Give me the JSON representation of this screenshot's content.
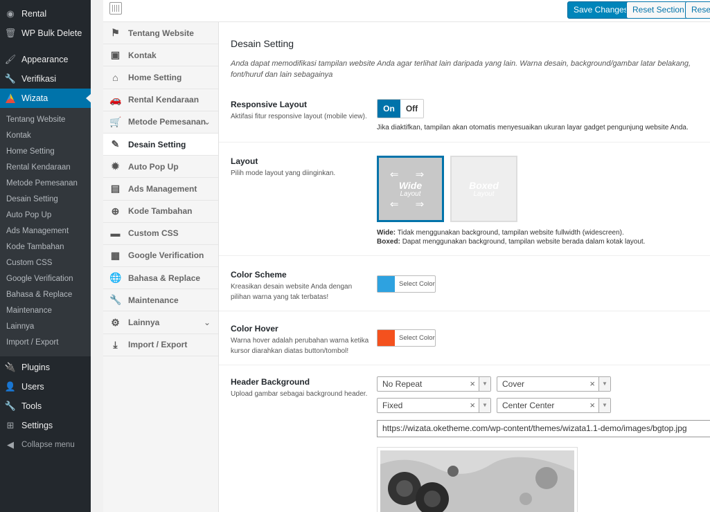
{
  "sidebar": {
    "top_items": [
      {
        "label": "Rental",
        "icon": "circle-icon"
      },
      {
        "label": "WP Bulk Delete",
        "icon": "trash-icon"
      },
      {
        "label": "Appearance",
        "icon": "brush-icon"
      },
      {
        "label": "Verifikasi",
        "icon": "wrench-icon"
      },
      {
        "label": "Wizata",
        "icon": "wizata-logo-icon"
      }
    ],
    "submenu": [
      "Tentang Website",
      "Kontak",
      "Home Setting",
      "Rental Kendaraan",
      "Metode Pemesanan",
      "Desain Setting",
      "Auto Pop Up",
      "Ads Management",
      "Kode Tambahan",
      "Custom CSS",
      "Google Verification",
      "Bahasa & Replace",
      "Maintenance",
      "Lainnya",
      "Import / Export"
    ],
    "bottom_items": [
      {
        "label": "Plugins",
        "icon": "plug-icon"
      },
      {
        "label": "Users",
        "icon": "user-icon"
      },
      {
        "label": "Tools",
        "icon": "wrench-icon"
      },
      {
        "label": "Settings",
        "icon": "settings-icon"
      }
    ],
    "collapse_label": "Collapse menu"
  },
  "toolbar": {
    "save_label": "Save Changes",
    "reset_section_label": "Reset Section",
    "reset_label": "Reset"
  },
  "nav": [
    {
      "label": "Tentang Website",
      "icon": "flag-icon"
    },
    {
      "label": "Kontak",
      "icon": "contact-card-icon"
    },
    {
      "label": "Home Setting",
      "icon": "home-icon"
    },
    {
      "label": "Rental Kendaraan",
      "icon": "car-icon"
    },
    {
      "label": "Metode Pemesanan",
      "icon": "cart-icon"
    },
    {
      "label": "Desain Setting",
      "icon": "magic-wand-icon"
    },
    {
      "label": "Auto Pop Up",
      "icon": "burst-icon"
    },
    {
      "label": "Ads Management",
      "icon": "chart-icon"
    },
    {
      "label": "Kode Tambahan",
      "icon": "plus-circle-icon"
    },
    {
      "label": "Custom CSS",
      "icon": "css-icon"
    },
    {
      "label": "Google Verification",
      "icon": "qrcode-icon"
    },
    {
      "label": "Bahasa & Replace",
      "icon": "globe-icon"
    },
    {
      "label": "Maintenance",
      "icon": "wrench-icon"
    },
    {
      "label": "Lainnya",
      "icon": "gears-icon"
    },
    {
      "label": "Import / Export",
      "icon": "download-icon"
    }
  ],
  "section": {
    "title": "Desain Setting",
    "description": "Anda dapat memodifikasi tampilan website Anda agar terlihat lain daripada yang lain. Warna desain, background/gambar latar belakang, font/huruf dan lain sebagainya"
  },
  "responsive": {
    "label": "Responsive Layout",
    "sub": "Aktifasi fitur responsive layout (mobile view).",
    "on": "On",
    "off": "Off",
    "note": "Jika diaktifkan, tampilan akan otomatis menyesuaikan ukuran layar gadget pengunjung website Anda."
  },
  "layout": {
    "label": "Layout",
    "sub": "Pilih mode layout yang diinginkan.",
    "wide_title": "Wide",
    "wide_sub": "Layout",
    "boxed_title": "Boxed",
    "boxed_sub": "Layout",
    "note_wide_key": "Wide:",
    "note_wide": "Tidak menggunakan background, tampilan website fullwidth (widescreen).",
    "note_boxed_key": "Boxed:",
    "note_boxed": "Dapat menggunakan background, tampilan website berada dalam kotak layout."
  },
  "color_scheme": {
    "label": "Color Scheme",
    "sub": "Kreasikan desain website Anda dengan pilihan warna yang tak terbatas!",
    "button": "Select Color",
    "color": "#2ea2e0"
  },
  "color_hover": {
    "label": "Color Hover",
    "sub": "Warna hover adalah perubahan warna ketika kursor diarahkan diatas button/tombol!",
    "button": "Select Color",
    "color": "#f4511e"
  },
  "header_bg": {
    "label": "Header Background",
    "sub": "Upload gambar sebagai background header.",
    "repeat": "No Repeat",
    "size": "Cover",
    "attachment": "Fixed",
    "position": "Center Center",
    "url": "https://wizata.oketheme.com/wp-content/themes/wizata1.1-demo/images/bgtop.jpg"
  }
}
